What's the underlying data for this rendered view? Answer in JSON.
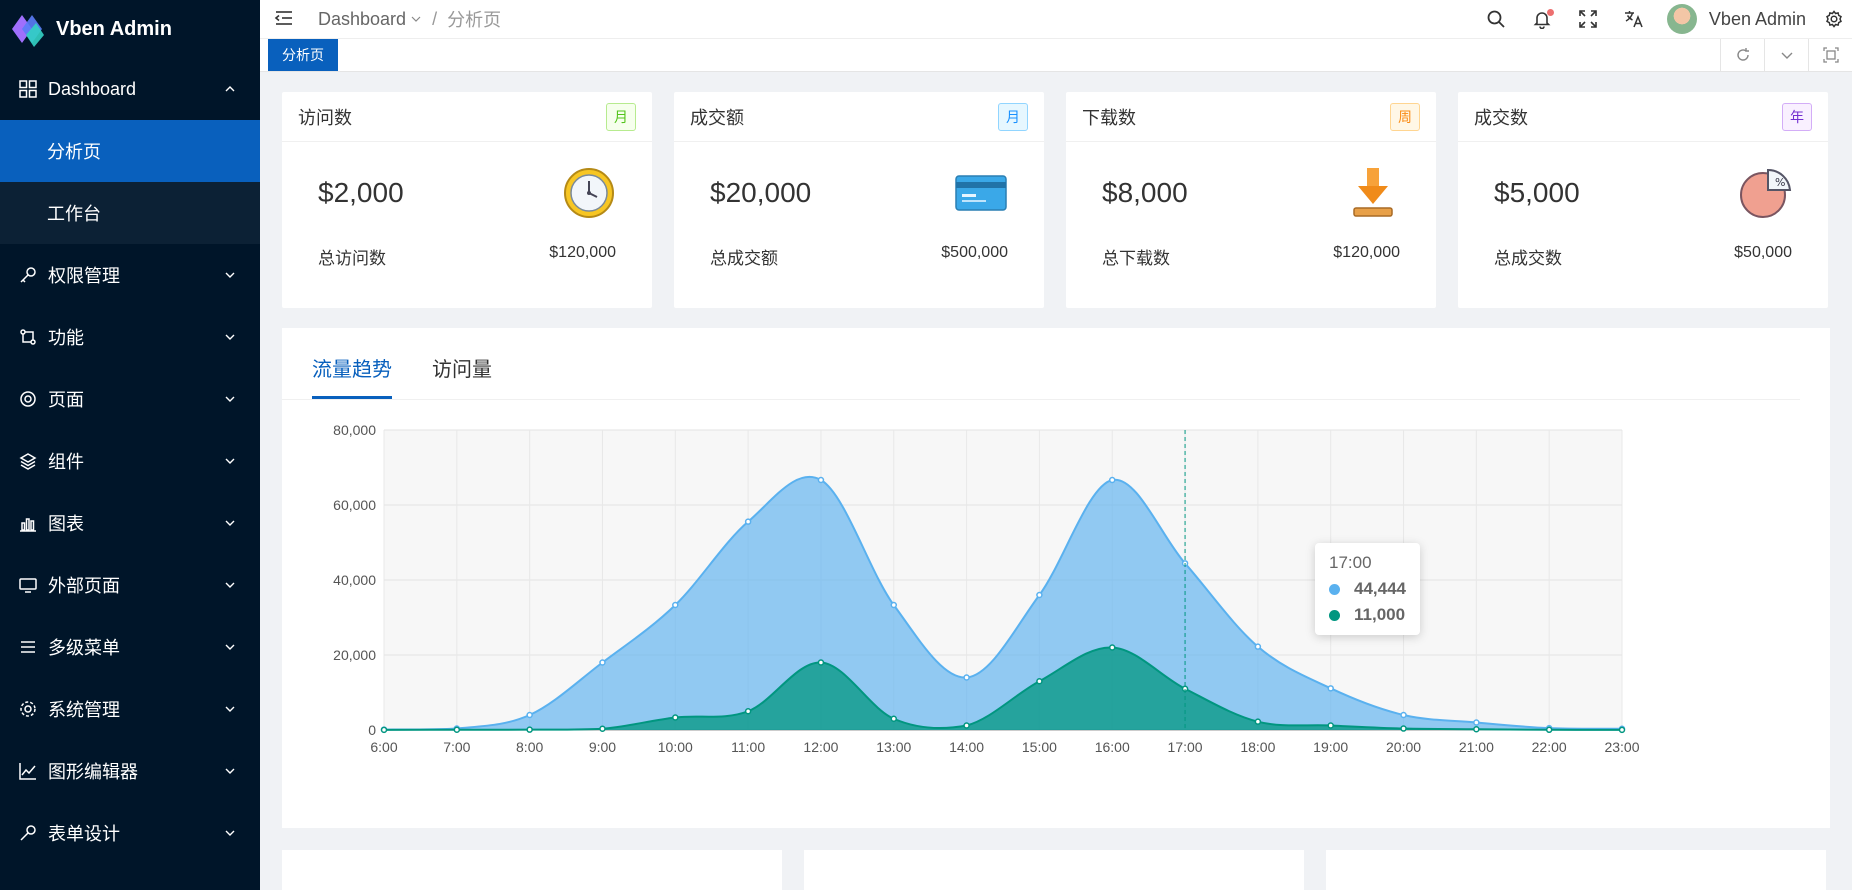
{
  "app": {
    "title": "Vben Admin"
  },
  "sidebar": {
    "items": [
      {
        "label": "Dashboard",
        "expanded": true,
        "children": [
          {
            "label": "分析页",
            "active": true
          },
          {
            "label": "工作台",
            "active": false
          }
        ]
      },
      {
        "label": "权限管理"
      },
      {
        "label": "功能"
      },
      {
        "label": "页面"
      },
      {
        "label": "组件"
      },
      {
        "label": "图表"
      },
      {
        "label": "外部页面"
      },
      {
        "label": "多级菜单"
      },
      {
        "label": "系统管理"
      },
      {
        "label": "图形编辑器"
      },
      {
        "label": "表单设计"
      }
    ]
  },
  "header": {
    "breadcrumb": [
      "Dashboard",
      "分析页"
    ],
    "user": "Vben Admin"
  },
  "tabs": {
    "items": [
      "分析页"
    ]
  },
  "cards": [
    {
      "title": "访问数",
      "badge": "月",
      "badge_color": "#52c41a",
      "amount": "$2,000",
      "footer_label": "总访问数",
      "footer_value": "$120,000",
      "icon": "clock-icon"
    },
    {
      "title": "成交额",
      "badge": "月",
      "badge_color": "#1890ff",
      "amount": "$20,000",
      "footer_label": "总成交额",
      "footer_value": "$500,000",
      "icon": "credit-card-icon"
    },
    {
      "title": "下载数",
      "badge": "周",
      "badge_color": "#fa8c16",
      "amount": "$8,000",
      "footer_label": "总下载数",
      "footer_value": "$120,000",
      "icon": "download-icon"
    },
    {
      "title": "成交数",
      "badge": "年",
      "badge_color": "#722ed1",
      "amount": "$5,000",
      "footer_label": "总成交数",
      "footer_value": "$50,000",
      "icon": "pie-percent-icon"
    }
  ],
  "chart_tabs": [
    "流量趋势",
    "访问量"
  ],
  "tooltip": {
    "time": "17:00",
    "values": [
      "44,444",
      "11,000"
    ]
  },
  "colors": {
    "primary": "#0960bd",
    "series1": "#5ab1ef",
    "series2": "#019680"
  },
  "chart_data": {
    "type": "area",
    "x": [
      "6:00",
      "7:00",
      "8:00",
      "9:00",
      "10:00",
      "11:00",
      "12:00",
      "13:00",
      "14:00",
      "15:00",
      "16:00",
      "17:00",
      "18:00",
      "19:00",
      "20:00",
      "21:00",
      "22:00",
      "23:00"
    ],
    "series": [
      {
        "values": [
          111,
          400,
          4000,
          18000,
          33333,
          55555,
          66666,
          33333,
          14000,
          36000,
          66666,
          44444,
          22222,
          11111,
          4000,
          2000,
          500,
          333
        ],
        "color": "#5ab1ef"
      },
      {
        "values": [
          33,
          66,
          88,
          333,
          3333,
          5000,
          18000,
          3000,
          1200,
          13000,
          22000,
          11000,
          2221,
          1201,
          390,
          198,
          60,
          30
        ],
        "color": "#019680"
      }
    ],
    "ylim": [
      0,
      80000
    ],
    "yticks": [
      "0",
      "20,000",
      "40,000",
      "60,000",
      "80,000"
    ],
    "grid": true,
    "highlight_index": 11
  }
}
